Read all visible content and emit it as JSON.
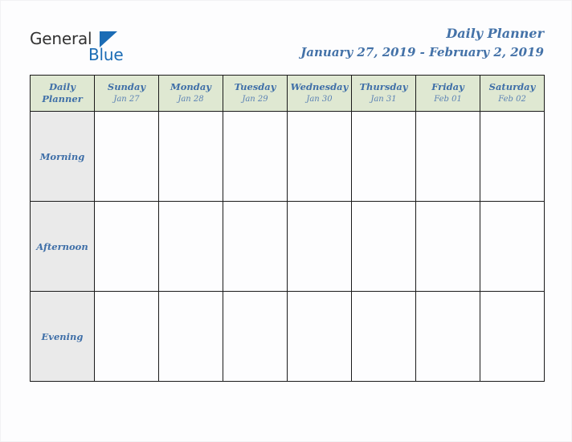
{
  "brand": {
    "name_part1": "General",
    "name_part2": "Blue",
    "triangle_icon": "blue-triangle-icon",
    "color_dark": "#333333",
    "color_blue": "#1b6cb5"
  },
  "header": {
    "title": "Daily Planner",
    "subtitle": "January 27, 2019 - February 2, 2019",
    "title_color": "#4472a8"
  },
  "table": {
    "corner_label_line1": "Daily",
    "corner_label_line2": "Planner",
    "header_bg": "#dfe8d2",
    "period_bg": "#eaeaea",
    "border_color": "#1a1a1a",
    "columns": [
      {
        "day": "Sunday",
        "date": "Jan 27"
      },
      {
        "day": "Monday",
        "date": "Jan 28"
      },
      {
        "day": "Tuesday",
        "date": "Jan 29"
      },
      {
        "day": "Wednesday",
        "date": "Jan 30"
      },
      {
        "day": "Thursday",
        "date": "Jan 31"
      },
      {
        "day": "Friday",
        "date": "Feb 01"
      },
      {
        "day": "Saturday",
        "date": "Feb 02"
      }
    ],
    "rows": [
      {
        "period": "Morning",
        "slots": [
          "",
          "",
          "",
          "",
          "",
          "",
          ""
        ]
      },
      {
        "period": "Afternoon",
        "slots": [
          "",
          "",
          "",
          "",
          "",
          "",
          ""
        ]
      },
      {
        "period": "Evening",
        "slots": [
          "",
          "",
          "",
          "",
          "",
          "",
          ""
        ]
      }
    ]
  }
}
